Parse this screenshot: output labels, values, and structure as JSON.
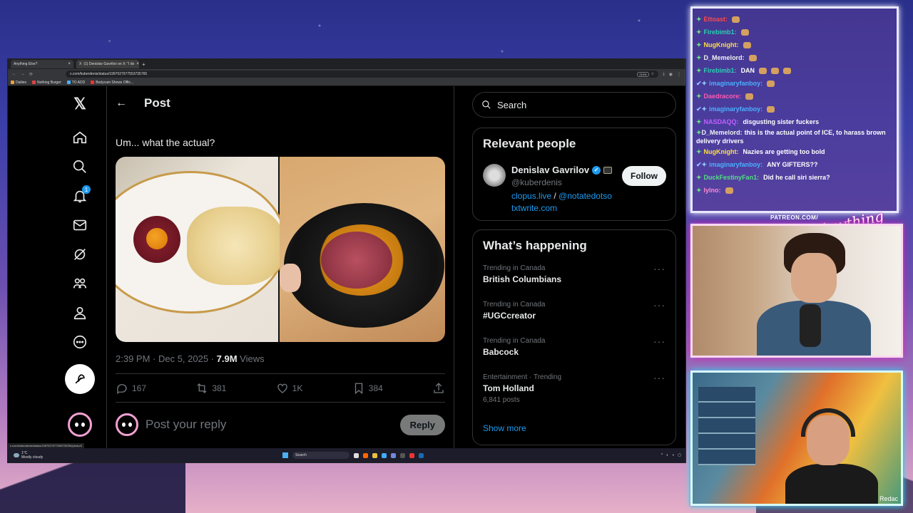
{
  "browser": {
    "tabs": [
      {
        "label": "Anything Else?",
        "active": false
      },
      {
        "label": "(1) Denislav Gavrilov on X: \"I do",
        "active": true
      }
    ],
    "url": "x.com/kuberdenis/status/1997027977553735765",
    "zoom": "210%",
    "bookmarks": [
      "Dailies",
      "Nothing Burger",
      "TO ADD",
      "Bodycam Shows Offic..."
    ],
    "status_url": "x.com/kuberdenis/status/1997027977553735765/photo/2"
  },
  "nav": {
    "notification_count": "1",
    "icons": [
      "x-logo-icon",
      "home-icon",
      "search-icon",
      "bell-icon",
      "mail-icon",
      "grok-icon",
      "communities-icon",
      "profile-icon",
      "more-icon"
    ]
  },
  "post": {
    "header_title": "Post",
    "text": "Um... what the actual?",
    "time": "2:39 PM · Dec 5, 2025 · ",
    "views_count": "7.9M",
    "views_label": " Views",
    "replies": "167",
    "reposts": "381",
    "likes": "1K",
    "bookmarks": "384",
    "reply_placeholder": "Post your reply",
    "reply_button": "Reply"
  },
  "sidebar": {
    "search_placeholder": "Search",
    "relevant_title": "Relevant people",
    "person": {
      "name": "Denislav Gavrilov",
      "handle": "@kuberdenis",
      "link1": "clopus.live",
      "sep": " / ",
      "link2": "@notatedotso",
      "link3": "txtwrite.com",
      "follow": "Follow"
    },
    "happening_title": "What’s happening",
    "trends": [
      {
        "context": "Trending in Canada",
        "name": "British Columbians",
        "posts": ""
      },
      {
        "context": "Trending in Canada",
        "name": "#UGCcreator",
        "posts": ""
      },
      {
        "context": "Trending in Canada",
        "name": "Babcock",
        "posts": ""
      },
      {
        "context": "Entertainment · Trending",
        "name": "Tom Holland",
        "posts": "6,841 posts"
      }
    ],
    "show_more": "Show more"
  },
  "taskbar": {
    "temp": "1°C",
    "weather": "Mostly cloudy",
    "search": "Search"
  },
  "chat": {
    "messages": [
      {
        "user": "Ettoast:",
        "color": "#ff4a4a",
        "text": "",
        "badge": "g",
        "emotes": 1
      },
      {
        "user": "Firebimb1:",
        "color": "#2bd0b0",
        "text": "",
        "badge": "g",
        "emotes": 1
      },
      {
        "user": "NugKnight:",
        "color": "#ffe040",
        "text": "",
        "badge": "g",
        "emotes": 1
      },
      {
        "user": "D_Memelord:",
        "color": "#f0f0f0",
        "text": "",
        "badge": "g",
        "emotes": 1
      },
      {
        "user": "Firebimb1:",
        "color": "#2bd0b0",
        "text": "DAN",
        "badge": "g",
        "emotes": 3
      },
      {
        "user": "imaginaryfanboy:",
        "color": "#4ab0ff",
        "text": "",
        "badge": "b",
        "emotes": 1
      },
      {
        "user": "Daedracore:",
        "color": "#ff5ab0",
        "text": "",
        "badge": "g",
        "emotes": 1
      },
      {
        "user": "imaginaryfanboy:",
        "color": "#4ab0ff",
        "text": "",
        "badge": "b",
        "emotes": 1
      },
      {
        "user": "NASDAQQ:",
        "color": "#c060ff",
        "text": "disgusting sister fuckers",
        "badge": "g",
        "emotes": 0
      },
      {
        "user": "D_Memelord:",
        "color": "#f0f0f0",
        "text": "this is the actual point of ICE, to harass brown delivery drivers",
        "badge": "g",
        "emotes": 0
      },
      {
        "user": "NugKnight:",
        "color": "#ffe040",
        "text": "Nazies are getting too bold",
        "badge": "g",
        "emotes": 0
      },
      {
        "user": "imaginaryfanboy:",
        "color": "#4ab0ff",
        "text": "ANY GIFTERS??",
        "badge": "b",
        "emotes": 0
      },
      {
        "user": "DuckFestinyFan1:",
        "color": "#50e080",
        "text": "Did he call siri sierra?",
        "badge": "g",
        "emotes": 0
      },
      {
        "user": "lylno:",
        "color": "#ff8ad0",
        "text": "",
        "badge": "g",
        "emotes": 1
      }
    ]
  },
  "overlay": {
    "patreon": "PATREON.COM/",
    "logo": "Anything Else?",
    "cam_label": "Redac"
  }
}
